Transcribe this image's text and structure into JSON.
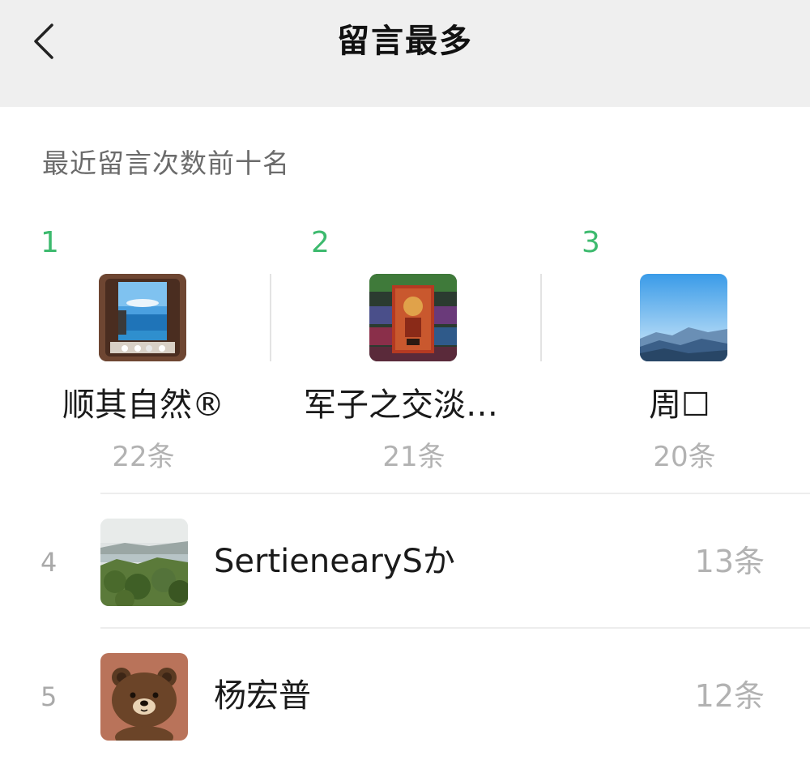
{
  "header": {
    "title": "留言最多",
    "back_icon": "chevron-left-icon"
  },
  "section": {
    "title": "最近留言次数前十名"
  },
  "colors": {
    "rank_accent": "#3dba6e",
    "muted_text": "#b2b2b2",
    "header_bg": "#efefef"
  },
  "top_three": [
    {
      "rank": "1",
      "name": "顺其自然®",
      "count": "22条",
      "avatar": "window-seascape-avatar"
    },
    {
      "rank": "2",
      "name": "军子之交淡…",
      "count": "21条",
      "avatar": "poster-collage-avatar"
    },
    {
      "rank": "3",
      "name": "周☐",
      "count": "20条",
      "avatar": "mountain-sky-avatar"
    }
  ],
  "list": [
    {
      "rank": "4",
      "name": "SertienearySか",
      "count": "13条",
      "avatar": "coastal-hills-avatar"
    },
    {
      "rank": "5",
      "name": "杨宏普",
      "count": "12条",
      "avatar": "brown-bear-avatar"
    }
  ]
}
